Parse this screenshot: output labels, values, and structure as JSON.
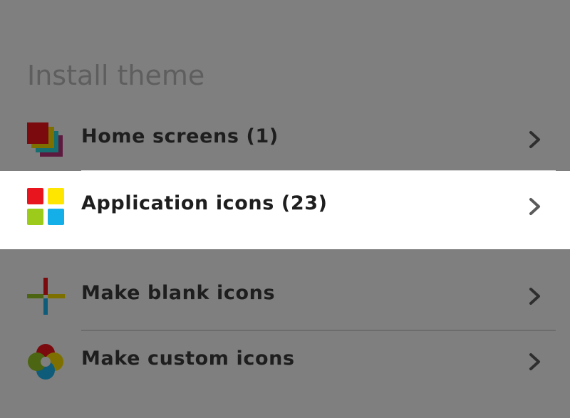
{
  "section": {
    "title": "Install theme"
  },
  "items": [
    {
      "label": "Home screens (1)",
      "icon": "layered-squares-icon",
      "chevron": "chevron-right-icon"
    },
    {
      "label": "Application icons (23)",
      "icon": "four-squares-icon",
      "chevron": "chevron-right-icon",
      "highlighted": true
    },
    {
      "label": "Make blank icons",
      "icon": "plus-cross-icon",
      "chevron": "chevron-right-icon"
    },
    {
      "label": "Make custom icons",
      "icon": "overlapping-circles-icon",
      "chevron": "chevron-right-icon"
    }
  ],
  "colors": {
    "overlay": "#7f7f7f",
    "highlight": "#ffffff",
    "label": "#1e1e1e",
    "title": "#5e5e5e",
    "red": "#e8141e",
    "yellow": "#ffe600",
    "green": "#9ccb1c",
    "blue": "#14aee8",
    "teal": "#138f93",
    "magenta": "#8c1b5e"
  }
}
